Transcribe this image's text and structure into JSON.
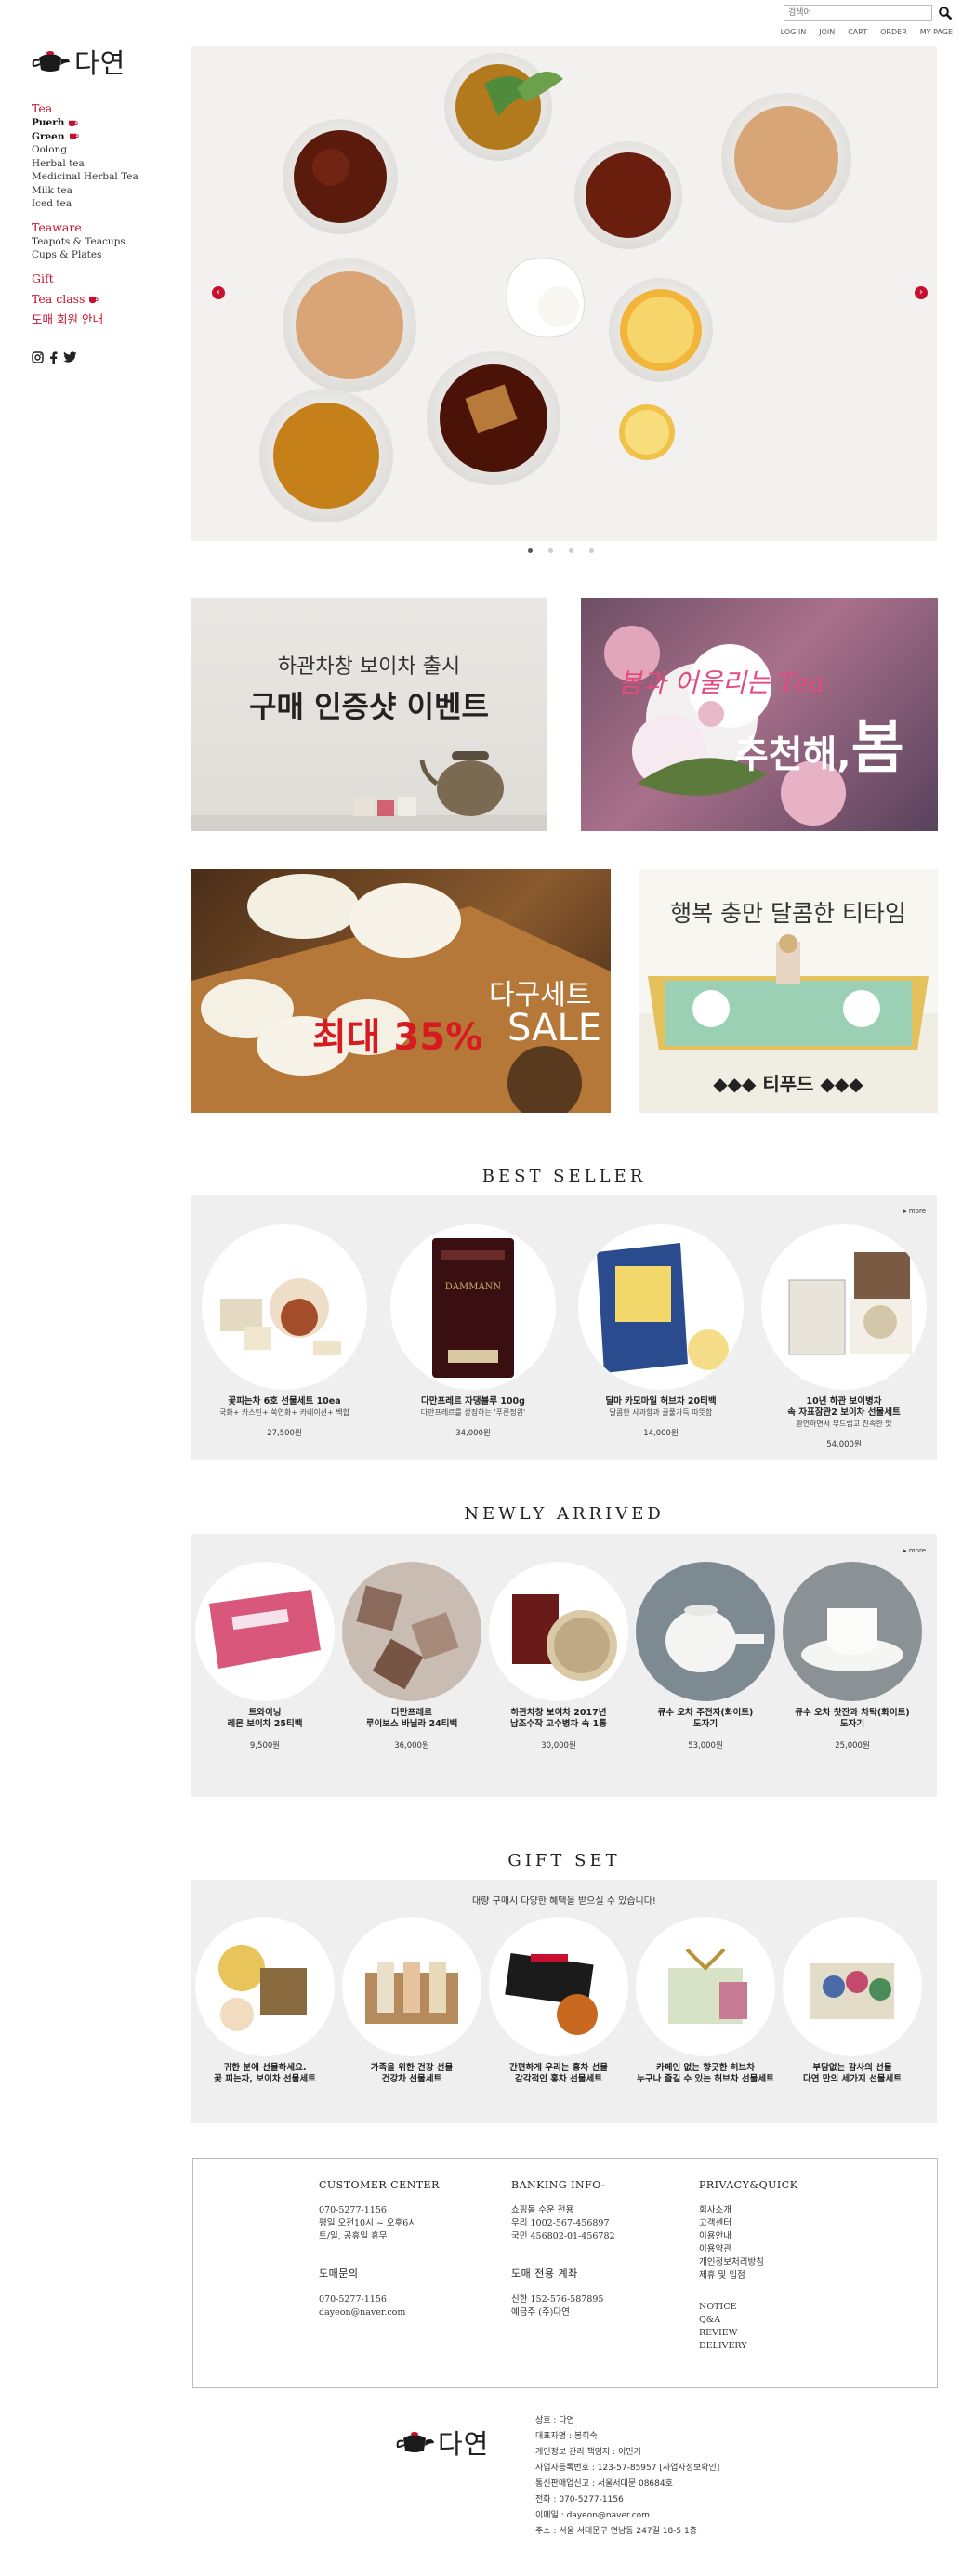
{
  "top": {
    "search_placeholder": "검색어",
    "links": [
      "LOG IN",
      "JOIN",
      "CART",
      "ORDER",
      "MY PAGE"
    ]
  },
  "brand": {
    "name": "다연"
  },
  "sidebar": {
    "groups": [
      {
        "head": "Tea",
        "items": [
          {
            "label": "Puerh",
            "bold": true,
            "cup": true
          },
          {
            "label": "Green",
            "bold": true,
            "cup": true
          },
          {
            "label": "Oolong"
          },
          {
            "label": "Herbal tea"
          },
          {
            "label": "Medicinal Herbal Tea"
          },
          {
            "label": "Milk tea"
          },
          {
            "label": "Iced tea"
          }
        ]
      },
      {
        "head": "Teaware",
        "items": [
          {
            "label": "Teapots & Teacups"
          },
          {
            "label": "Cups & Plates"
          }
        ]
      }
    ],
    "extra": [
      {
        "label": "Gift",
        "cup": false
      },
      {
        "label": "Tea class",
        "cup": true
      },
      {
        "label": "도매 회원 안내",
        "cup": false
      }
    ],
    "social_icons": [
      "instagram-icon",
      "facebook-icon",
      "twitter-icon"
    ]
  },
  "slider": {
    "dots": 4,
    "active": 0,
    "prev": "‹",
    "next": "›"
  },
  "banners": {
    "b1": {
      "line1": "하관차창 보이차 출시",
      "line2": "구매 인증샷 이벤트"
    },
    "b2": {
      "script": "봄과 어울리는 Tea",
      "main": "추천해,",
      "big": "봄"
    },
    "b3": {
      "line1": "다구세트",
      "red": "최대 35%",
      "white": "SALE"
    },
    "b4": {
      "line1": "행복 충만 달콤한 티타임",
      "line2": "◆◆◆ 티푸드 ◆◆◆"
    }
  },
  "best": {
    "title": "BEST SELLER",
    "more": "▸ more",
    "items": [
      {
        "name": "꽃피는차 6호 선물세트 10ea",
        "desc": "국화+ 카스틴+ 쑥연화+ 카네이션+ 백합",
        "price": "27,500원"
      },
      {
        "name": "다만프레르 자댕블루 100g",
        "desc": "다만프레르를 상징하는 '푸른정원'",
        "price": "34,000원"
      },
      {
        "name": "딜마 카모마일 허브차 20티백",
        "desc": "달콤한 사과향과 꿀풀가득 따뜻함",
        "price": "14,000원"
      },
      {
        "name": "10년 하관 보이병차",
        "name2": "속 자표잠관2 보이차 선물세트",
        "desc": "환언하면서 부드럽고 진속한 맛",
        "price": "54,000원"
      }
    ]
  },
  "newly": {
    "title": "NEWLY ARRIVED",
    "more": "▸ more",
    "items": [
      {
        "name": "트와이닝",
        "name2": "레몬 보이차 25티백",
        "price": "9,500원"
      },
      {
        "name": "다만프레르",
        "name2": "루이보스 바닐라 24티백",
        "price": "36,000원"
      },
      {
        "name": "하관차창 보이차 2017년",
        "name2": "남조수작 고수병차 속 1통",
        "price": "30,000원"
      },
      {
        "name": "큐수 오차 주전자(화이트)",
        "name2": "도자기",
        "price": "53,000원"
      },
      {
        "name": "큐수 오차 찻잔과 차탁(화이트)",
        "name2": "도자기",
        "price": "25,000원"
      }
    ]
  },
  "gift": {
    "title": "GIFT SET",
    "note": "대량 구매시 다양한 혜택을 받으실 수 있습니다!",
    "items": [
      {
        "line1": "귀한 분에 선물하세요.",
        "line2": "꽃 피는차, 보이차 선물세트"
      },
      {
        "line1": "가족을 위한 건강 선물",
        "line2": "건강차 선물세트"
      },
      {
        "line1": "간편하게 우리는 홍차 선물",
        "line2": "감각적인 홍차 선물세트"
      },
      {
        "line1": "카페인 없는 향긋한 허브차",
        "line2": "누구나 즐길 수 있는 허브차 선물세트"
      },
      {
        "line1": "부담없는 감사의 선물",
        "line2": "다연 만의 세가지 선물세트"
      }
    ]
  },
  "footer": {
    "cc_title": "CUSTOMER CENTER",
    "cc_lines": [
      "070-5277-1156",
      "평일 오전10시 ~ 오후6시",
      "토/일, 공휴일 휴무"
    ],
    "wholesale_title": "도매문의",
    "wholesale_lines": [
      "070-5277-1156",
      "dayeon@naver.com"
    ],
    "bank_title": "BANKING INFO-",
    "bank_lines": [
      "쇼핑몰 수운 전용",
      "우리 1002-567-456897",
      "국민 456802-01-456782"
    ],
    "bank2_title": "도매 전용 계좌",
    "bank2_lines": [
      "신한 152-576-587895",
      "예금주 (주)다연"
    ],
    "privacy_title": "PRIVACY&QUICK",
    "privacy_links": [
      "회사소개",
      "고객센터",
      "이용안내",
      "이용약관",
      "개인정보처리방침",
      "제휴 및 입점"
    ],
    "quick_links": [
      "NOTICE",
      "Q&A",
      "REVIEW",
      "DELIVERY"
    ]
  },
  "company": {
    "lines": [
      "상호 : 다연",
      "대표자명 : 봉희숙",
      "개인정보 관리 책임자 : 이민기",
      "사업자등록번호 : 123-57-85957 [사업자정보확인]",
      "통신판매업신고 : 서울서대문 08684호",
      "전화 : 070-5277-1156",
      "이메일 : dayeon@naver.com",
      "주소 : 서울 서대문구 연남동 247길 18-5 1층"
    ]
  },
  "colors": {
    "accent": "#c8102e",
    "panel": "#efefef"
  }
}
